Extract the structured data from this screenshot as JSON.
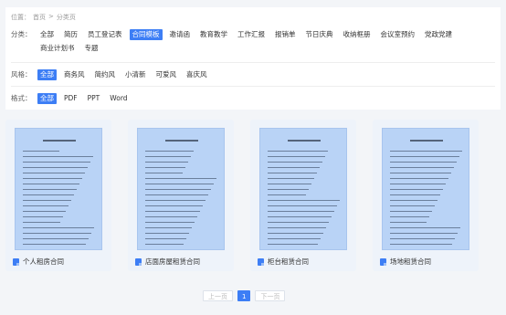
{
  "breadcrumb": {
    "label": "位置：",
    "home": "首页",
    "separator": ">",
    "current": "分类页"
  },
  "filters": {
    "category": {
      "label": "分类：",
      "options": [
        "全部",
        "简历",
        "员工登记表",
        "合同模板",
        "邀请函",
        "教育教学",
        "工作汇报",
        "报销单",
        "节日庆典",
        "收纳框册",
        "会议室预约",
        "党政党建",
        "商业计划书",
        "专题"
      ],
      "active": "合同模板"
    },
    "style": {
      "label": "风格：",
      "options": [
        "全部",
        "商务风",
        "简约风",
        "小清新",
        "可爱风",
        "喜庆风"
      ],
      "active": "全部"
    },
    "format": {
      "label": "格式：",
      "options": [
        "全部",
        "PDF",
        "PPT",
        "Word"
      ],
      "active": "全部"
    }
  },
  "cards": [
    {
      "title": "个人租房合同",
      "icon": "document-icon"
    },
    {
      "title": "店面房屋租赁合同",
      "icon": "document-icon"
    },
    {
      "title": "柜台租赁合同",
      "icon": "document-icon"
    },
    {
      "title": "场地租赁合同",
      "icon": "document-icon"
    }
  ],
  "pagination": {
    "prev": "上一页",
    "current": "1",
    "next": "下一页"
  },
  "colors": {
    "accent": "#3d7ef5",
    "thumbnail": "#b9d3f6",
    "card_bg": "#eef3fa",
    "page_bg": "#f3f5f8"
  }
}
